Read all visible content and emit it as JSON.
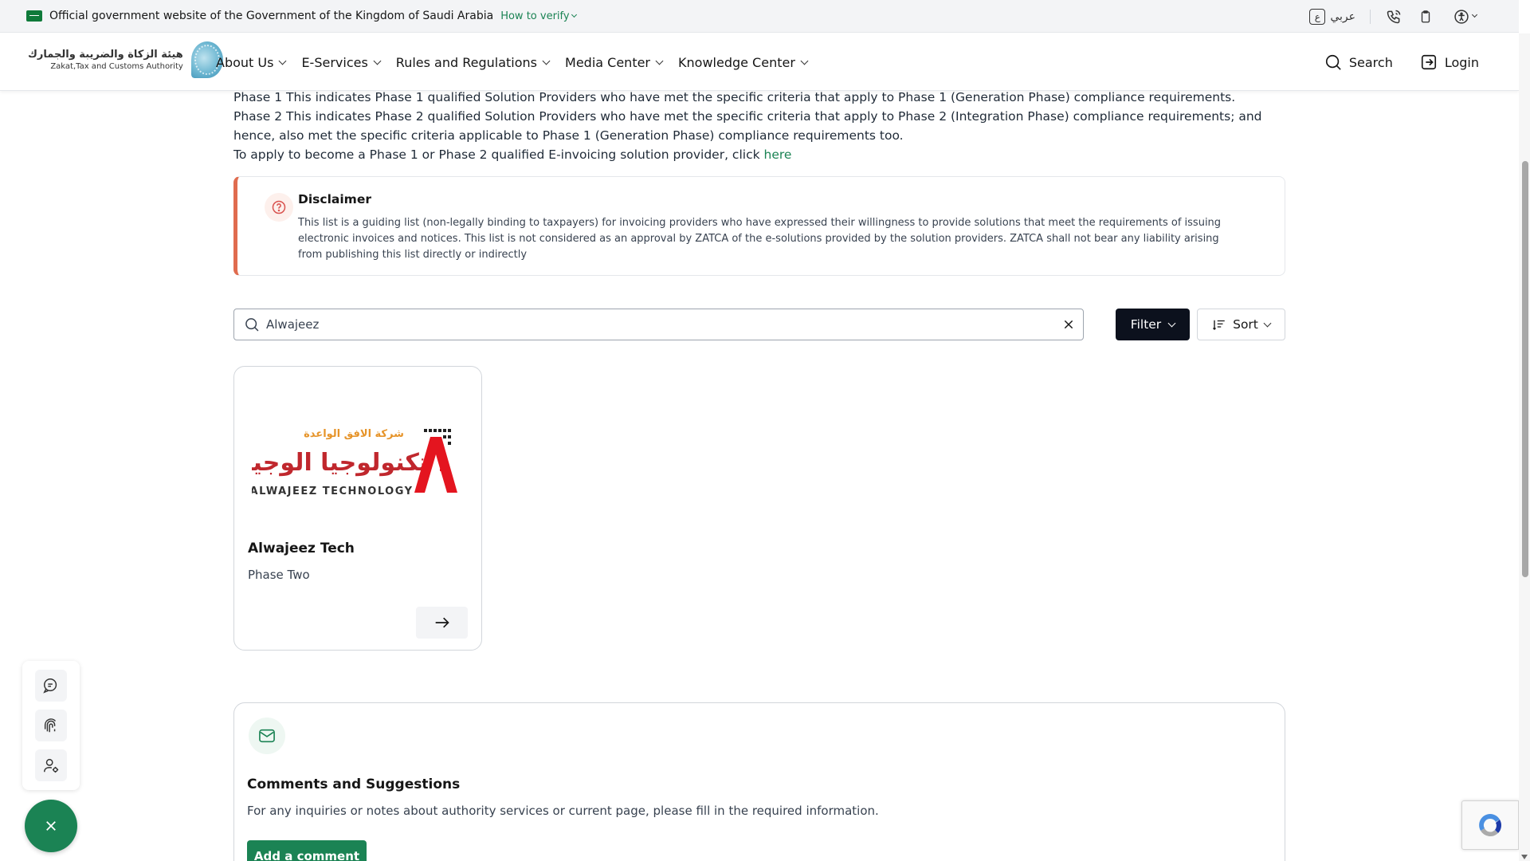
{
  "govbar": {
    "text": "Official government website of the Government of the Kingdom of Saudi Arabia",
    "verify_label": "How to verify",
    "lang_label": "عربي",
    "icons": [
      "language-icon",
      "phone-icon",
      "clipboard-icon",
      "accessibility-icon"
    ]
  },
  "header": {
    "logo_ar": "هيئة الزكاة والضريبة والجمارك",
    "logo_en": "Zakat,Tax and Customs Authority",
    "menu": [
      {
        "label": "About Us"
      },
      {
        "label": "E-Services"
      },
      {
        "label": "Rules and Regulations"
      },
      {
        "label": "Media Center"
      },
      {
        "label": "Knowledge Center"
      }
    ],
    "search_label": "Search",
    "login_label": "Login"
  },
  "intro": {
    "line1": "Phase 1 This indicates Phase 1 qualified Solution Providers who have met the specific criteria that apply to Phase 1 (Generation Phase) compliance requirements.",
    "line2": "Phase 2 This indicates Phase 2 qualified Solution Providers who have met the specific criteria that apply to Phase 2 (Integration Phase) compliance requirements; and hence, also met the specific criteria applicable to Phase 1 (Generation Phase) compliance requirements too.",
    "line3_prefix": "To apply to become a Phase 1 or Phase 2 qualified E-invoicing solution provider, click ",
    "line3_link": "here"
  },
  "disclaimer": {
    "title": "Disclaimer",
    "body": "This list is a guiding list (non-legally binding to taxpayers) for invoicing providers who have expressed their willingness to provide solutions that meet the requirements of issuing electronic invoices and notices. This list is not considered as an approval by ZATCA of the e-solutions provided by the solution providers. ZATCA shall not bear any liability arising from publishing this list directly or indirectly"
  },
  "search": {
    "value": "Alwajeez",
    "filter_label": "Filter",
    "sort_label": "Sort"
  },
  "results": [
    {
      "logo_ar_small": "شركة الافق الواعدة",
      "logo_ar_big": "تكنولوجيا الوجيز",
      "logo_en": "ALWAJEEZ TECHNOLOGY",
      "title": "Alwajeez Tech",
      "phase": "Phase Two"
    }
  ],
  "comments": {
    "title": "Comments and Suggestions",
    "desc": "For any inquiries or notes about authority services or current page, please fill in the required information.",
    "button_label": "Add a comment"
  },
  "float_toolbar": {
    "icons": [
      "chat-icon",
      "fingerprint-icon",
      "user-settings-icon"
    ],
    "fab_icon": "close-icon"
  },
  "colors": {
    "brand_green": "#1b8354",
    "dark_button": "#0c111d",
    "disclaimer_accent": "#e06c4f"
  }
}
